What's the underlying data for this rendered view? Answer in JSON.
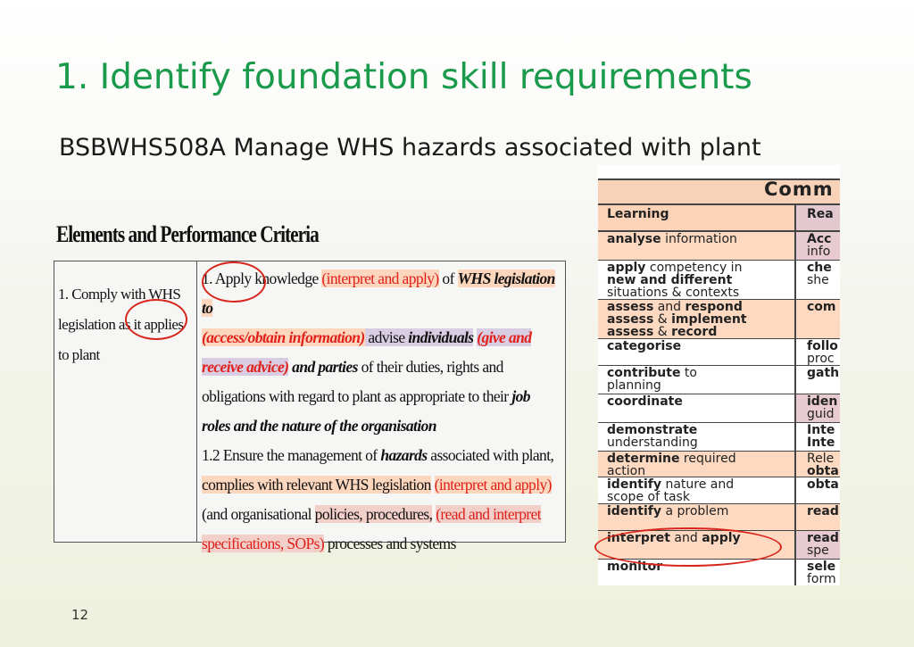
{
  "slide": {
    "title": "1. Identify foundation skill requirements",
    "subtitle": "BSBWHS508A Manage WHS hazards associated with plant",
    "page_number": "12"
  },
  "criteria_table": {
    "heading": "Elements and Performance Criteria",
    "element": "1. Comply with WHS legislation as it applies to plant",
    "pc_1": {
      "t1": "1. Apply knowledge ",
      "t2": "(interpret and apply)",
      "t3": " of ",
      "t4": "WHS legislation to",
      "t5": "(access/obtain information)",
      "t6": " advise ",
      "t7": "individuals",
      "t8": " ",
      "t9": "(give and receive advice)",
      "t10": " ",
      "t11": "and parties",
      "t12": " of their duties, rights and obligations with regard to plant as appropriate to their ",
      "t13": "job roles and the nature of the organisation"
    },
    "pc_2": {
      "t1": "1.2 Ensure the management of ",
      "t2": "hazards",
      "t3": " associated with plant, ",
      "t4": "complies with relevant WHS legislation",
      "t5": " ",
      "t6": "(interpret and apply)",
      "t7": " (and organisational ",
      "t8": "policies, procedures,",
      "t9": " ",
      "t10": "(read and interpret specifications, SOPs)",
      "t11": " processes and systems"
    }
  },
  "verbs_table": {
    "title": "Comm",
    "col1_header": "Learning",
    "col2_header": "Rea",
    "rows": [
      {
        "bold": "analyse",
        "rest": " information",
        "c2a": "Acc",
        "c2b": "info"
      },
      {
        "bold": "apply",
        "rest": " competency in",
        "bold2": "new and different",
        "rest2": "situations & contexts",
        "c2a": "che",
        "c2b": "she"
      },
      {
        "bold": "assess",
        "rest": " and ",
        "bold_b": "respond",
        "bold2": "assess",
        "rest2": " & ",
        "bold2b": "implement",
        "bold3": "assess",
        "rest3": " & ",
        "bold3b": "record",
        "c2a": "com",
        "c2b": ""
      },
      {
        "bold": "categorise",
        "rest": "",
        "c2a": "follo",
        "c2b": "proc"
      },
      {
        "bold": "contribute",
        "rest": " to",
        "rest2": "planning",
        "c2a": "gath",
        "c2b": ""
      },
      {
        "bold": "coordinate",
        "rest": "",
        "c2a": "iden",
        "c2b": "guid"
      },
      {
        "bold": "demonstrate",
        "rest": "",
        "rest2": "understanding",
        "c2a": "Inte",
        "c2b": "Inte"
      },
      {
        "bold": "determine",
        "rest": " required",
        "rest2": "action",
        "c2a": "Rele",
        "c2b": "obta"
      },
      {
        "bold": "identify",
        "rest": " nature and",
        "rest2": "scope of task",
        "c2a": "obta",
        "c2b": ""
      },
      {
        "bold": "identify",
        "rest": " a problem",
        "c2a": "read",
        "c2b": ""
      },
      {
        "bold": "interpret",
        "rest": " and ",
        "bold_b": "apply",
        "c2a": "read",
        "c2b": "spe"
      },
      {
        "bold": "monitor",
        "rest": "",
        "c2a": "sele",
        "c2b": "form"
      }
    ]
  },
  "colors": {
    "title_green": "#1a9a4b",
    "annotation_red": "#d7261c",
    "highlight_orange": "#fcd6bd",
    "highlight_purple": "#d9cde3",
    "highlight_pink": "#f2cfc9"
  }
}
